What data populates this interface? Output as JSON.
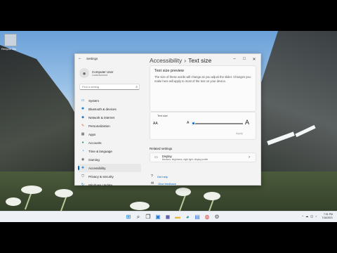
{
  "desktop": {
    "icon_label": "Recycle Bin"
  },
  "window": {
    "app_title": "Settings",
    "buttons": [
      "–",
      "□",
      "✕"
    ],
    "user": {
      "name": "Computer User",
      "account": "Local Account"
    },
    "search": {
      "placeholder": "Find a setting"
    },
    "nav": [
      {
        "label": "System",
        "icon": "system-icon",
        "glyph": "▭",
        "color": "#0067c0"
      },
      {
        "label": "Bluetooth & devices",
        "icon": "bluetooth-icon",
        "glyph": "✱",
        "color": "#0078d4"
      },
      {
        "label": "Network & internet",
        "icon": "network-icon",
        "glyph": "◆",
        "color": "#2a6fb8"
      },
      {
        "label": "Personalization",
        "icon": "brush-icon",
        "glyph": "✎",
        "color": "#d26a2e"
      },
      {
        "label": "Apps",
        "icon": "apps-icon",
        "glyph": "▦",
        "color": "#555"
      },
      {
        "label": "Accounts",
        "icon": "accounts-icon",
        "glyph": "●",
        "color": "#1e9c5a"
      },
      {
        "label": "Time & language",
        "icon": "time-icon",
        "glyph": "◔",
        "color": "#1565c0"
      },
      {
        "label": "Gaming",
        "icon": "gaming-icon",
        "glyph": "◉",
        "color": "#666"
      },
      {
        "label": "Accessibility",
        "icon": "accessibility-icon",
        "glyph": "✚",
        "color": "#1f7ad6",
        "active": true
      },
      {
        "label": "Privacy & security",
        "icon": "shield-icon",
        "glyph": "⛉",
        "color": "#555"
      },
      {
        "label": "Windows Update",
        "icon": "update-icon",
        "glyph": "↻",
        "color": "#0067c0"
      }
    ],
    "breadcrumb": {
      "parent": "Accessibility",
      "separator": "›",
      "current": "Text size"
    },
    "preview": {
      "title": "Text size preview",
      "text": "The size of these words will change as you adjust the slider. Changes you make here will apply to most of the text on your device."
    },
    "text_size": {
      "label": "Text size",
      "preview_glyph": "AA",
      "small_a": "A",
      "large_a": "A",
      "level": 0.02,
      "apply_label": "Apply"
    },
    "related": {
      "title": "Related settings",
      "display_title": "Display",
      "display_desc": "Monitors, brightness, night light, display profile"
    },
    "links": [
      {
        "label": "Get help",
        "icon": "help-icon",
        "glyph": "?"
      },
      {
        "label": "Give feedback",
        "icon": "feedback-icon",
        "glyph": "✉"
      }
    ]
  },
  "taskbar": {
    "icons": [
      {
        "name": "start-icon",
        "glyph": "⊞",
        "color": "#0078d4"
      },
      {
        "name": "search-taskbar-icon",
        "glyph": "⌕",
        "color": "#333"
      },
      {
        "name": "task-view-icon",
        "glyph": "❐",
        "color": "#333"
      },
      {
        "name": "widgets-icon",
        "glyph": "▣",
        "color": "#2a7bd6"
      },
      {
        "name": "chat-icon",
        "glyph": "◼",
        "color": "#6264a7"
      },
      {
        "name": "explorer-icon",
        "glyph": "▬",
        "color": "#e8b83a"
      },
      {
        "name": "edge-icon",
        "glyph": "◕",
        "color": "#1e9c8a"
      },
      {
        "name": "store-icon",
        "glyph": "▤",
        "color": "#3a7bd5"
      },
      {
        "name": "chrome-icon",
        "glyph": "◍",
        "color": "#d9463c"
      },
      {
        "name": "settings-taskbar-icon",
        "glyph": "⚙",
        "color": "#555"
      }
    ],
    "tray": [
      "^",
      "☁",
      "◱",
      "♪"
    ],
    "time": "7:31 PM",
    "date": "7/16/2021"
  }
}
